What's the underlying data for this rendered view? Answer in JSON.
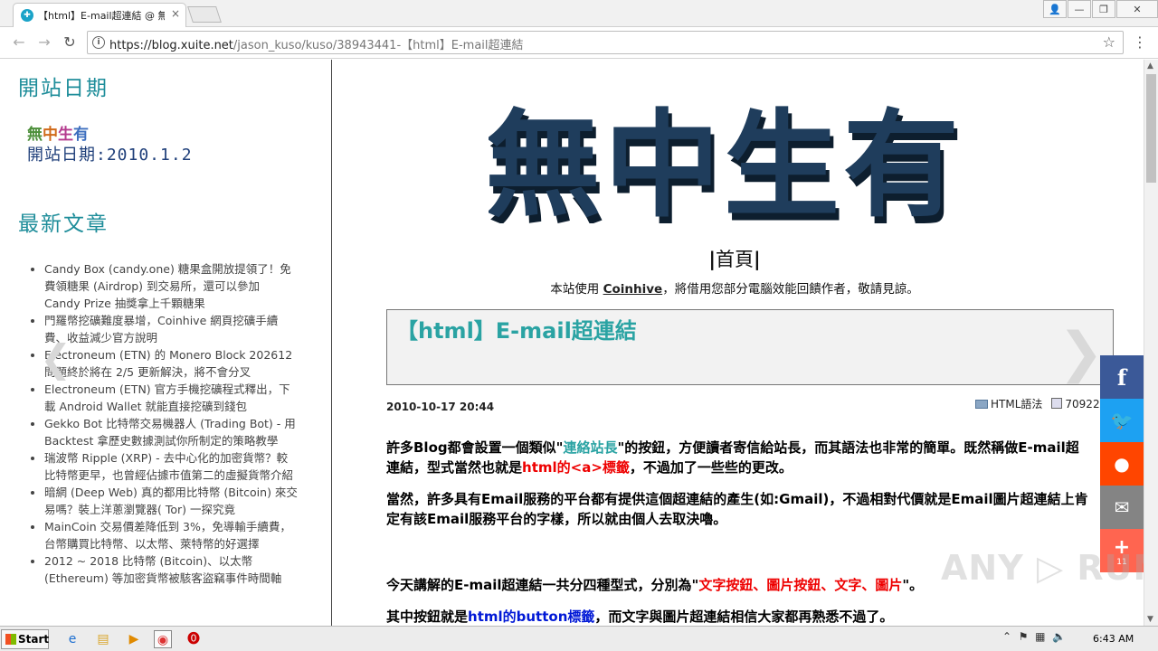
{
  "browser": {
    "tab_title": "【html】E-mail超連結 @ 無中生",
    "tab_favicon": "✚",
    "tab_close": "×",
    "url_host": "https://blog.xuite.net",
    "url_path": "/jason_kuso/kuso/38943441-【html】E-mail超連結",
    "back_icon": "←",
    "forward_icon": "→",
    "reload_icon": "↻",
    "info_icon": "i",
    "star_icon": "☆",
    "menu_icon": "⋮",
    "window_user_icon": "👤",
    "window_min_icon": "—",
    "window_max_icon": "❐",
    "window_close_icon": "✕"
  },
  "sidebar": {
    "heading_launch": "開站日期",
    "launch_badge_line1": [
      "無",
      "中",
      "生",
      "有"
    ],
    "launch_badge_line2": "開站日期:2010.1.2",
    "heading_latest": "最新文章",
    "prev_arrow": "❮",
    "articles": [
      "Candy Box (candy.one) 糖果盒開放提領了！免費領糖果 (Airdrop) 到交易所，還可以參加 Candy Prize 抽獎拿上千顆糖果",
      "門羅幣挖礦難度暴增，Coinhive 網頁挖礦手續費、收益減少官方說明",
      "Electroneum (ETN) 的 Monero Block 202612 問題終於將在 2/5 更新解決，將不會分叉",
      "Electroneum (ETN) 官方手機挖礦程式釋出，下載 Android Wallet 就能直接挖礦到錢包",
      "Gekko Bot 比特幣交易機器人 (Trading Bot) - 用 Backtest 拿歷史數據測試你所制定的策略教學",
      "瑞波幣 Ripple (XRP) - 去中心化的加密貨幣？較比特幣更早，也曾經佔據市值第二的虛擬貨幣介紹",
      "暗網 (Deep Web) 真的都用比特幣 (Bitcoin) 來交易嗎？裝上洋蔥瀏覽器( Tor) 一探究竟",
      "MainCoin 交易價差降低到 3%，免導輸手續費，台幣購買比特幣、以太幣、萊特幣的好選擇",
      "2012 ~ 2018 比特幣 (Bitcoin)、以太幣 (Ethereum) 等加密貨幣被駭客盜竊事件時間軸"
    ]
  },
  "main": {
    "logo_text": "無中生有",
    "nav_home": "首頁",
    "coinhive_before": "本站使用 ",
    "coinhive_link": "Coinhive",
    "coinhive_after": "，將借用您部分電腦效能回饋作者，敬請見諒。",
    "post_title": "【html】E-mail超連結",
    "next_arrow": "❯",
    "post_date": "2010-10-17 20:44",
    "post_category": "HTML語法",
    "post_views": "70922",
    "paragraphs": {
      "p1_a": "許多Blog都會設置一個類似\"",
      "p1_b": "連絡站長",
      "p1_c": "\"的按鈕，方便讀者寄信給站長，而其語法也非常的簡單。既然稱做E-mail超連結，型式當然也就是",
      "p1_d": "html的<a>標籤",
      "p1_e": "，不過加了一些些的更改。",
      "p2": "當然，許多具有Email服務的平台都有提供這個超連結的產生(如:Gmail)，不過相對代價就是Email圖片超連結上肯定有該Email服務平台的字樣，所以就由個人去取決嚕。",
      "p3_a": "今天講解的E-mail超連結一共分四種型式，分別為\"",
      "p3_b": "文字按鈕、圖片按鈕、文字、圖片",
      "p3_c": "\"。",
      "p4_a": "其中按鈕就是",
      "p4_b": "html的button標籤",
      "p4_c": "，而文字與圖片超連結相信大家都再熟悉不過了。"
    }
  },
  "share": {
    "facebook_icon": "f",
    "twitter_icon": "🐦",
    "reddit_icon": "●",
    "email_icon": "✉",
    "more_icon": "+",
    "more_count": "11"
  },
  "watermark": "ANY ▷ RUN",
  "taskbar": {
    "start_label": "Start",
    "clock": "6:43 AM"
  },
  "colors": {
    "heading_teal": "#1e8d9a",
    "title_teal": "#2aa3a3",
    "logo_navy": "#1f3d5c",
    "link_red": "#e00000",
    "link_blue": "#0018d6"
  }
}
